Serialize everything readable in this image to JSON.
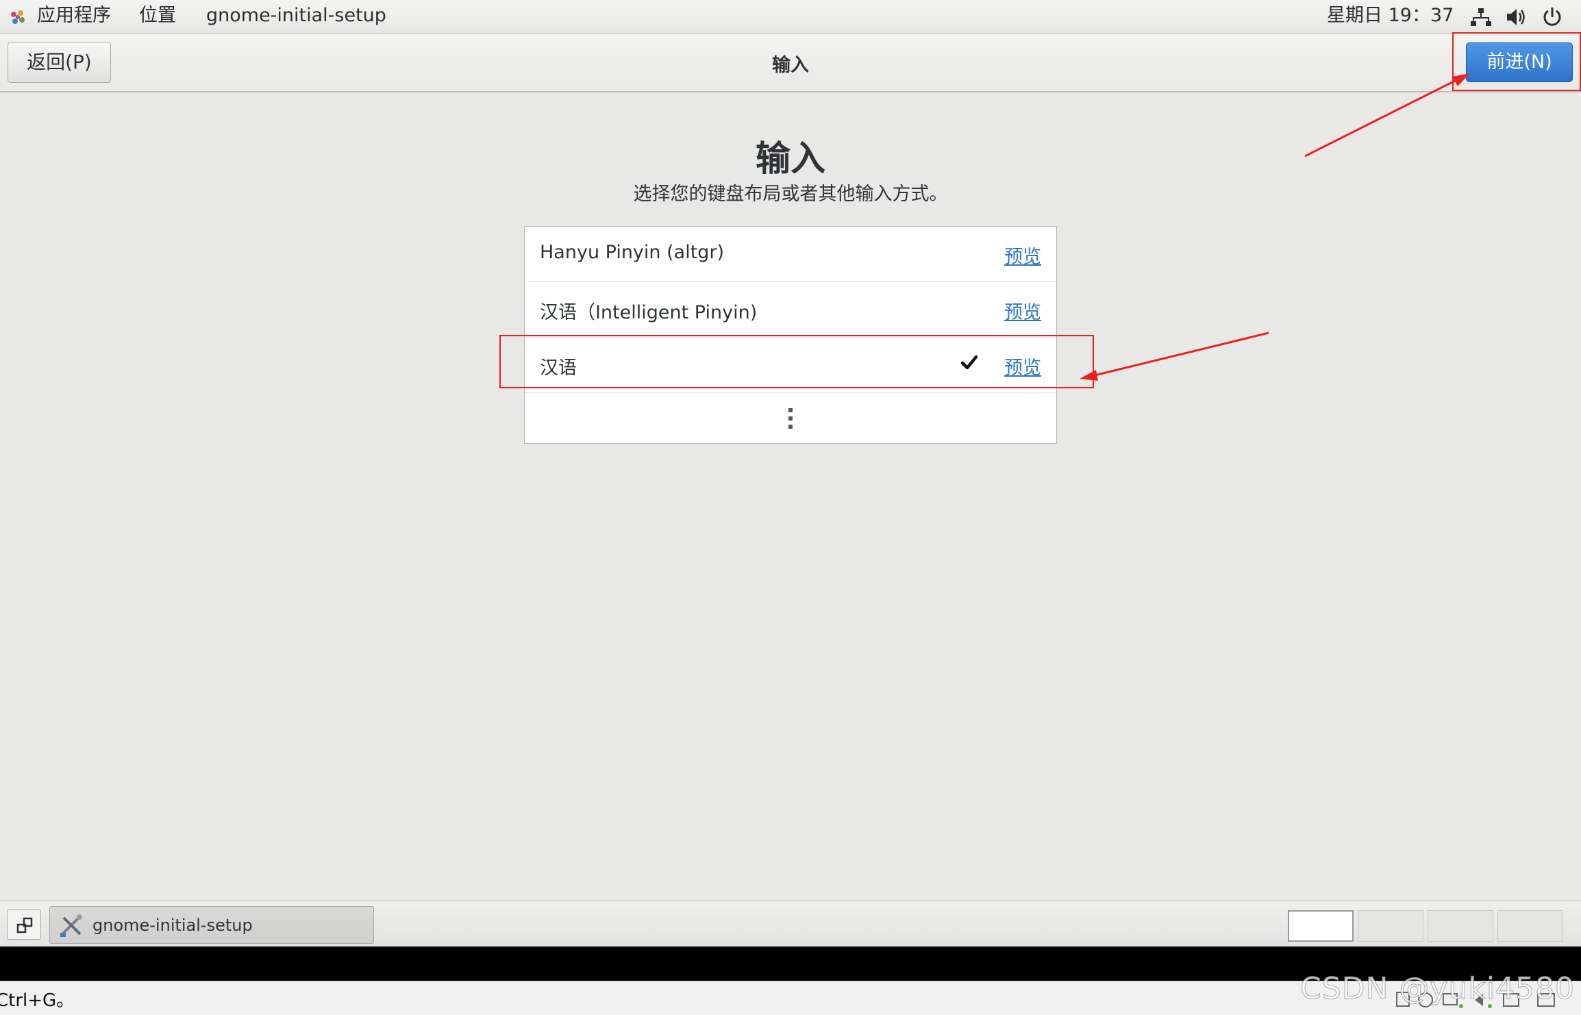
{
  "top_panel": {
    "applications": "应用程序",
    "places": "位置",
    "app_name": "gnome-initial-setup",
    "clock": "星期日 19：37",
    "icons": [
      "network-icon",
      "volume-icon",
      "power-icon"
    ]
  },
  "header": {
    "back_label": "返回(P)",
    "title": "输入",
    "next_label": "前进(N)"
  },
  "main": {
    "title": "输入",
    "subtitle": "选择您的键盘布局或者其他输入方式。",
    "sources": [
      {
        "label": "Hanyu Pinyin (altgr)",
        "preview": "预览",
        "selected": false
      },
      {
        "label": "汉语（Intelligent Pinyin)",
        "preview": "预览",
        "selected": false
      },
      {
        "label": "汉语",
        "preview": "预览",
        "selected": true
      }
    ],
    "more_icon": "more-vertical-icon"
  },
  "taskbar": {
    "task_label": "gnome-initial-setup",
    "workspace_count": 4,
    "active_workspace": 1
  },
  "host": {
    "status_text": "Ctrl+G。",
    "watermark": "CSDN @yuki4580"
  },
  "colors": {
    "accent": "#2f73c9",
    "link": "#2a76c6",
    "annotation": "#e8231f",
    "background": "#e8e8e7"
  }
}
